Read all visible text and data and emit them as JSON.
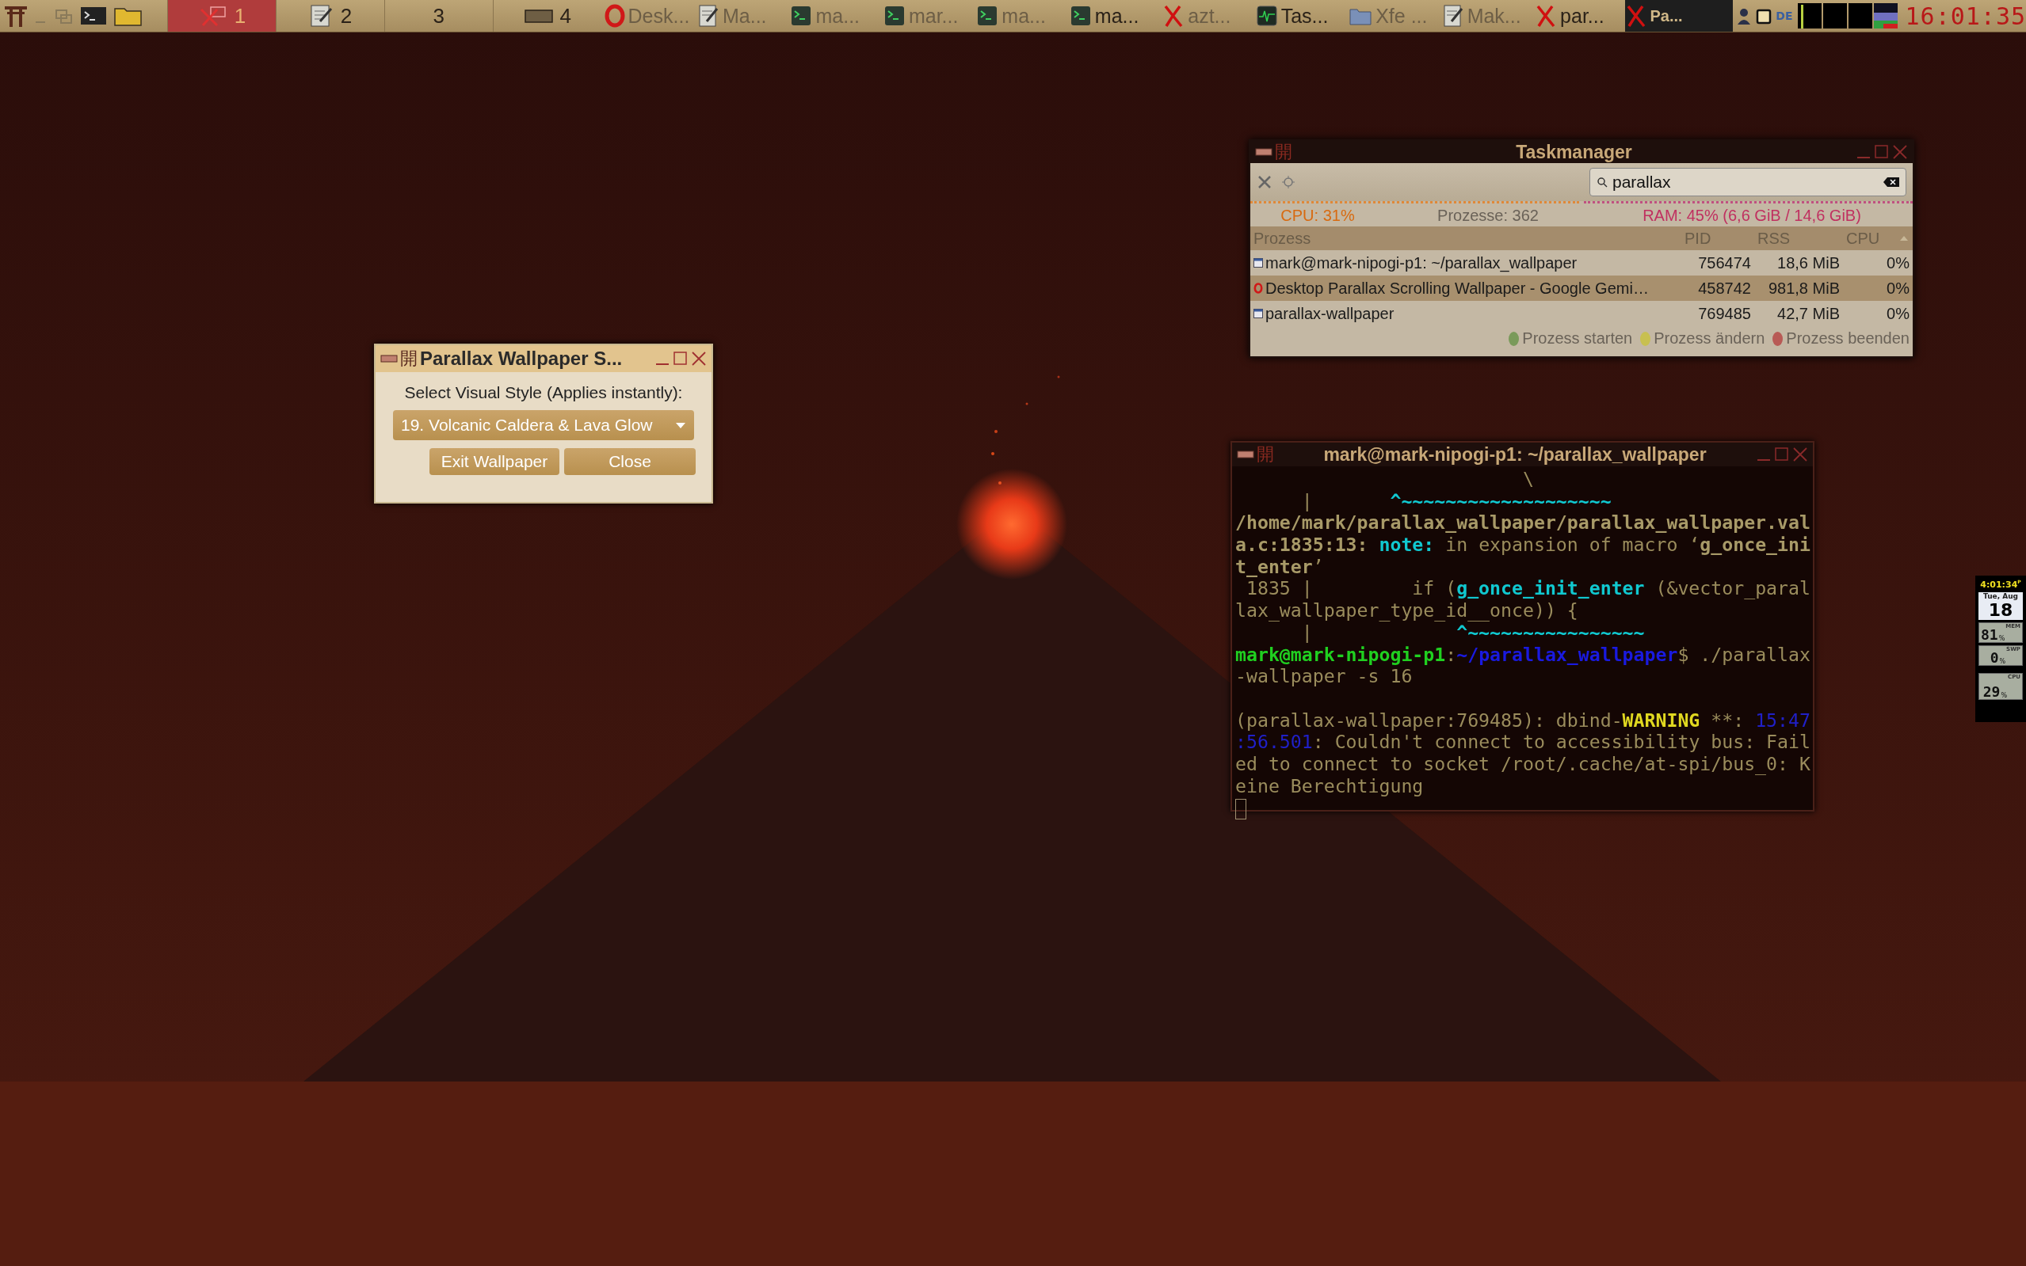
{
  "taskbar": {
    "workspaces": [
      {
        "label": "1",
        "kind": "x",
        "selected": true
      },
      {
        "label": "2",
        "kind": "editor",
        "selected": false
      },
      {
        "label": "3",
        "kind": "empty",
        "selected": false
      },
      {
        "label": "4",
        "kind": "window",
        "selected": false
      }
    ],
    "tasks": [
      {
        "label": "Desk...",
        "kind": "browser",
        "minimized": true,
        "selected": false
      },
      {
        "label": "Ma...",
        "kind": "editor",
        "minimized": true,
        "selected": false
      },
      {
        "label": "ma...",
        "kind": "terminal",
        "minimized": true,
        "selected": false
      },
      {
        "label": "mar...",
        "kind": "terminal",
        "minimized": true,
        "selected": false
      },
      {
        "label": "ma...",
        "kind": "terminal",
        "minimized": true,
        "selected": false
      },
      {
        "label": "ma...",
        "kind": "terminal",
        "minimized": false,
        "selected": false
      },
      {
        "label": "azt...",
        "kind": "x",
        "minimized": true,
        "selected": false
      },
      {
        "label": "Tas...",
        "kind": "monitor",
        "minimized": false,
        "selected": false
      },
      {
        "label": "Xfe ...",
        "kind": "files",
        "minimized": true,
        "selected": false
      },
      {
        "label": "Mak...",
        "kind": "editor",
        "minimized": true,
        "selected": false
      },
      {
        "label": "par...",
        "kind": "x",
        "minimized": false,
        "selected": false
      },
      {
        "label": "Pa...",
        "kind": "x",
        "minimized": false,
        "selected": true
      }
    ],
    "keyboard_layout": "DE",
    "clock": "16:01:35"
  },
  "dialog": {
    "menu_glyph": "開",
    "title": "Parallax Wallpaper S...",
    "prompt": "Select Visual Style (Applies instantly):",
    "style_select": {
      "value": "19. Volcanic Caldera & Lava Glow"
    },
    "buttons": [
      "Exit Wallpaper",
      "Close"
    ]
  },
  "taskmanager": {
    "menu_glyph": "開",
    "title": "Taskmanager",
    "search": {
      "value": "parallax"
    },
    "stats": {
      "cpu": "CPU: 31%",
      "processes": "Prozesse: 362",
      "ram": "RAM: 45% (6,6 GiB / 14,6 GiB)"
    },
    "columns": [
      "Prozess",
      "PID",
      "RSS",
      "CPU"
    ],
    "rows": [
      {
        "kind": "window",
        "name": "mark@mark-nipogi-p1: ~/parallax_wallpaper",
        "pid": "756474",
        "rss": "18,6 MiB",
        "cpu": "0%"
      },
      {
        "kind": "browser",
        "name": "Desktop Parallax Scrolling Wallpaper - Google Gemi…",
        "pid": "458742",
        "rss": "981,8 MiB",
        "cpu": "0%"
      },
      {
        "kind": "window",
        "name": "parallax-wallpaper",
        "pid": "769485",
        "rss": "42,7 MiB",
        "cpu": "0%"
      }
    ],
    "actions": [
      {
        "label": "Prozess starten",
        "color": "#7a9a5a"
      },
      {
        "label": "Prozess ändern",
        "color": "#c8c050"
      },
      {
        "label": "Prozess beenden",
        "color": "#b85a55"
      }
    ]
  },
  "terminal": {
    "menu_glyph": "開",
    "title": "mark@mark-nipogi-p1: ~/parallax_wallpaper",
    "lines": [
      {
        "kind": "text",
        "segments": [
          {
            "kind": "plain",
            "text": "                          \\"
          }
        ]
      },
      {
        "kind": "text",
        "segments": [
          {
            "kind": "plain",
            "text": "      |       "
          },
          {
            "kind": "cyan",
            "text": "^~~~~~~~~~~~~~~~~~~~"
          }
        ]
      },
      {
        "kind": "text",
        "segments": [
          {
            "kind": "bold",
            "text": "/home/mark/parallax_wallpaper/parallax_wallpaper.val"
          }
        ]
      },
      {
        "kind": "text",
        "segments": [
          {
            "kind": "bold",
            "text": "a.c:1835:13: "
          },
          {
            "kind": "cyan",
            "text": "note:"
          },
          {
            "kind": "plain",
            "text": " in expansion of macro ‘"
          },
          {
            "kind": "bold",
            "text": "g_once_ini"
          }
        ]
      },
      {
        "kind": "text",
        "segments": [
          {
            "kind": "bold",
            "text": "t_enter"
          },
          {
            "kind": "plain",
            "text": "’"
          }
        ]
      },
      {
        "kind": "text",
        "segments": [
          {
            "kind": "plain",
            "text": " 1835 |         if ("
          },
          {
            "kind": "cyan",
            "text": "g_once_init_enter"
          },
          {
            "kind": "plain",
            "text": " (&vector_paral"
          }
        ]
      },
      {
        "kind": "text",
        "segments": [
          {
            "kind": "plain",
            "text": "lax_wallpaper_type_id__once)) {"
          }
        ]
      },
      {
        "kind": "text",
        "segments": [
          {
            "kind": "plain",
            "text": "      |             "
          },
          {
            "kind": "cyan",
            "text": "^~~~~~~~~~~~~~~~~"
          }
        ]
      },
      {
        "kind": "text",
        "segments": [
          {
            "kind": "green",
            "text": "mark@mark-nipogi-p1"
          },
          {
            "kind": "plain",
            "text": ":"
          },
          {
            "kind": "blue",
            "text": "~/parallax_wallpaper"
          },
          {
            "kind": "plain",
            "text": "$ ./parallax"
          }
        ]
      },
      {
        "kind": "text",
        "segments": [
          {
            "kind": "plain",
            "text": "-wallpaper -s 16"
          }
        ]
      },
      {
        "kind": "blank"
      },
      {
        "kind": "text",
        "segments": [
          {
            "kind": "plain",
            "text": "(parallax-wallpaper:769485): dbind-"
          },
          {
            "kind": "yellow",
            "text": "WARNING"
          },
          {
            "kind": "plain",
            "text": " **: "
          },
          {
            "kind": "time",
            "text": "15:47"
          }
        ]
      },
      {
        "kind": "text",
        "segments": [
          {
            "kind": "time",
            "text": ":56.501"
          },
          {
            "kind": "plain",
            "text": ": Couldn't connect to accessibility bus: Fail"
          }
        ]
      },
      {
        "kind": "text",
        "segments": [
          {
            "kind": "plain",
            "text": "ed to connect to socket /root/.cache/at-spi/bus_0: K"
          }
        ]
      },
      {
        "kind": "text",
        "segments": [
          {
            "kind": "plain",
            "text": "eine Berechtigung"
          }
        ]
      },
      {
        "kind": "cursor"
      }
    ]
  },
  "widget": {
    "time": "4:01:34",
    "meridiem": "P",
    "date": "Tue, Aug",
    "day": "18",
    "meters": [
      {
        "value": "81",
        "unit": "%",
        "label": "MEM"
      },
      {
        "value": "0",
        "unit": "%",
        "label": "SWP"
      },
      {
        "value": "29",
        "unit": "%",
        "label": "CPU"
      }
    ]
  }
}
